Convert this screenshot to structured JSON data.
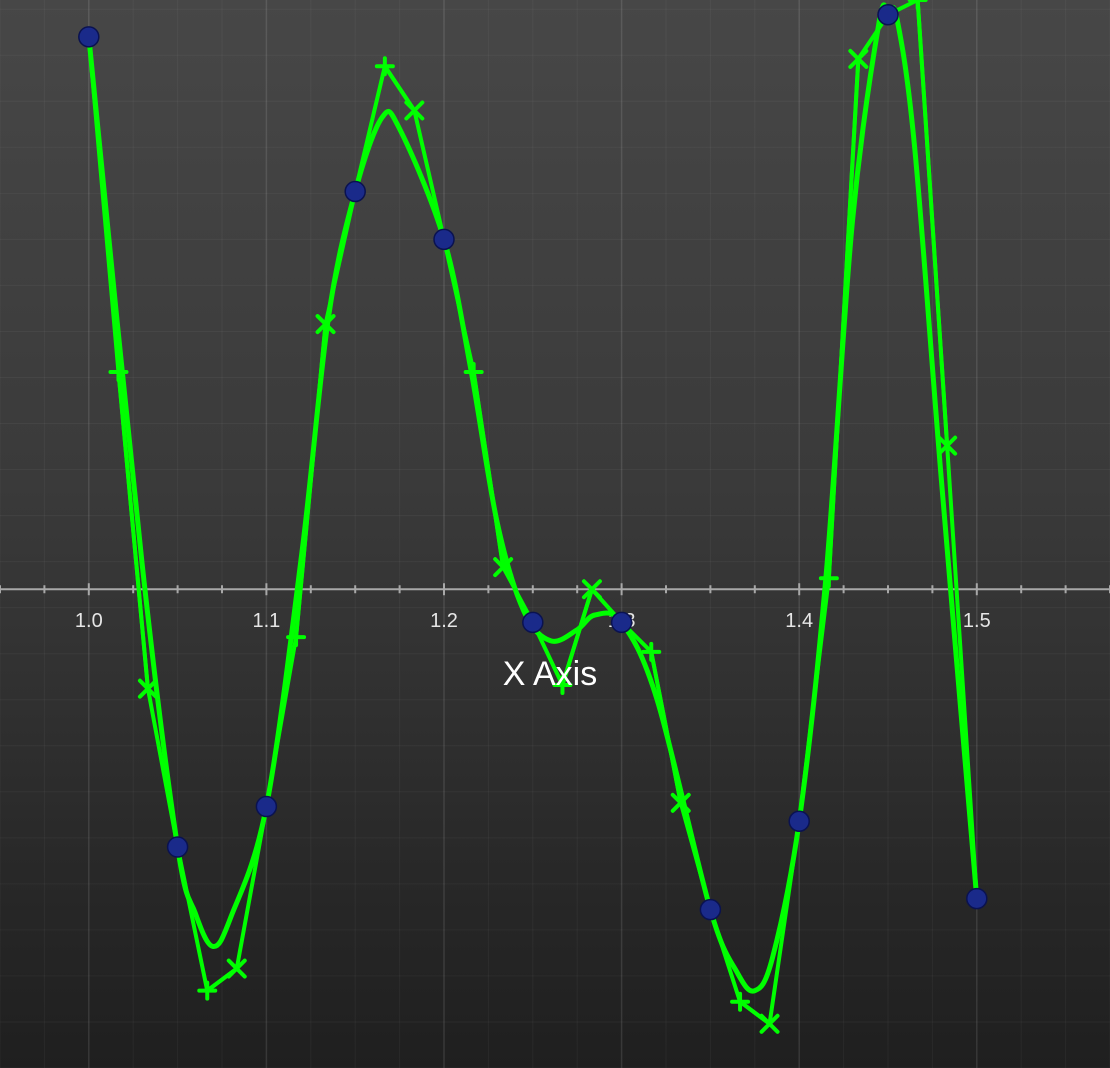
{
  "chart_data": {
    "type": "line",
    "xlabel": "X Axis",
    "x_ticks": [
      "1.0",
      "1.1",
      "1.2",
      "1.3",
      "1.4",
      "1.5"
    ],
    "xlim": [
      0.95,
      1.575
    ],
    "ylim": [
      -1.3,
      1.6
    ],
    "grid": true,
    "colors": {
      "curve": "#00ff00",
      "points": "#1a2a8a",
      "axis": "#a8a8a8"
    },
    "series": [
      {
        "kind": "data-points",
        "x": [
          1.0,
          1.05,
          1.1,
          1.15,
          1.2,
          1.25,
          1.3,
          1.35,
          1.4,
          1.45,
          1.5
        ],
        "y": [
          1.5,
          -0.7,
          -0.59,
          1.08,
          0.95,
          -0.09,
          -0.09,
          -0.87,
          -0.63,
          1.56,
          -0.84
        ]
      },
      {
        "kind": "interpolating-curve",
        "x": [
          1.0,
          1.03,
          1.05,
          1.06,
          1.07,
          1.08,
          1.1,
          1.12,
          1.135,
          1.15,
          1.165,
          1.175,
          1.2,
          1.215,
          1.23,
          1.245,
          1.26,
          1.275,
          1.285,
          1.3,
          1.32,
          1.35,
          1.365,
          1.375,
          1.385,
          1.4,
          1.415,
          1.43,
          1.445,
          1.45,
          1.455,
          1.465,
          1.48,
          1.5
        ],
        "y": [
          1.5,
          0.07,
          -0.7,
          -0.88,
          -0.97,
          -0.89,
          -0.59,
          0.1,
          0.74,
          1.08,
          1.28,
          1.25,
          0.95,
          0.6,
          0.18,
          -0.06,
          -0.14,
          -0.11,
          -0.07,
          -0.09,
          -0.3,
          -0.87,
          -1.04,
          -1.09,
          -1.0,
          -0.63,
          0.03,
          1.0,
          1.54,
          1.56,
          1.55,
          1.2,
          0.3,
          -0.84
        ]
      },
      {
        "kind": "polyline",
        "x": [
          1.0,
          1.0167,
          1.0333,
          1.05,
          1.0667,
          1.0833,
          1.1,
          1.1167,
          1.1333,
          1.15,
          1.1667,
          1.1833,
          1.2,
          1.2167,
          1.2333,
          1.25,
          1.2667,
          1.2833,
          1.3,
          1.3167,
          1.3333,
          1.35,
          1.3667,
          1.3833,
          1.4,
          1.4167,
          1.4333,
          1.45,
          1.4667,
          1.4833,
          1.5
        ],
        "y": [
          1.5,
          0.59,
          -0.27,
          -0.7,
          -1.09,
          -1.03,
          -0.59,
          -0.13,
          0.72,
          1.08,
          1.42,
          1.3,
          0.95,
          0.59,
          0.06,
          -0.09,
          -0.26,
          0.0,
          -0.09,
          -0.17,
          -0.58,
          -0.87,
          -1.12,
          -1.18,
          -0.63,
          0.03,
          1.44,
          1.56,
          1.6,
          0.39,
          -0.84
        ]
      },
      {
        "kind": "tangent-markers",
        "segments": [
          {
            "from": [
              1.0167,
              0.59
            ],
            "to": [
              1.0333,
              -0.27
            ]
          },
          {
            "from": [
              1.0667,
              -1.09
            ],
            "to": [
              1.0833,
              -1.03
            ]
          },
          {
            "from": [
              1.1167,
              -0.13
            ],
            "to": [
              1.1333,
              0.72
            ]
          },
          {
            "from": [
              1.1667,
              1.42
            ],
            "to": [
              1.1833,
              1.3
            ]
          },
          {
            "from": [
              1.2167,
              0.59
            ],
            "to": [
              1.2333,
              0.06
            ]
          },
          {
            "from": [
              1.2667,
              -0.26
            ],
            "to": [
              1.2833,
              0.0
            ]
          },
          {
            "from": [
              1.3167,
              -0.17
            ],
            "to": [
              1.3333,
              -0.58
            ]
          },
          {
            "from": [
              1.3667,
              -1.12
            ],
            "to": [
              1.3833,
              -1.18
            ]
          },
          {
            "from": [
              1.4167,
              0.03
            ],
            "to": [
              1.4333,
              1.44
            ]
          },
          {
            "from": [
              1.4667,
              1.6
            ],
            "to": [
              1.4833,
              0.39
            ]
          }
        ]
      }
    ]
  }
}
